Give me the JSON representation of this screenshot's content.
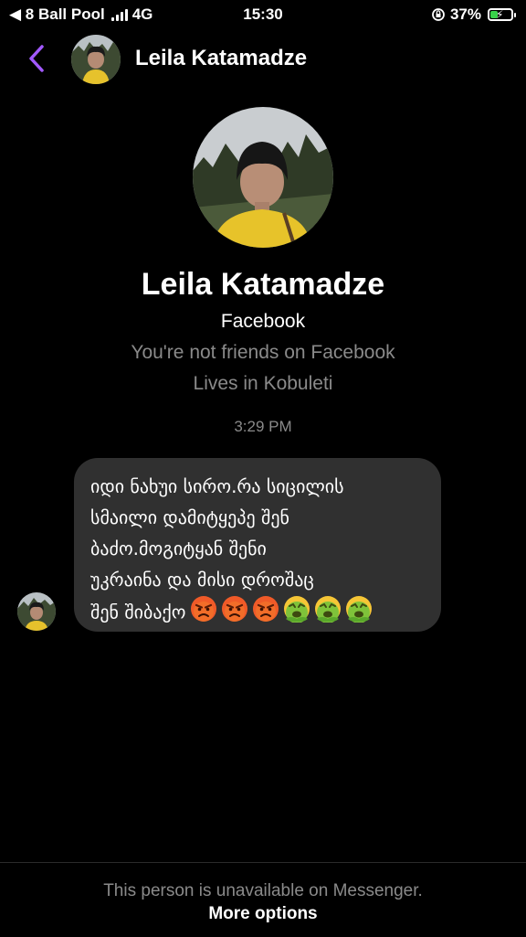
{
  "status_bar": {
    "back_app": "◀ 8 Ball Pool",
    "network": "4G",
    "time": "15:30",
    "battery": "37%",
    "battery_level": 0.37,
    "battery_color": "#39d24a"
  },
  "header": {
    "back_icon": "chevron-left-icon",
    "accent": "#a259ff",
    "name": "Leila Katamadze"
  },
  "profile": {
    "name": "Leila Katamadze",
    "source": "Facebook",
    "friend_status": "You're not friends on Facebook",
    "location": "Lives in Kobuleti"
  },
  "conversation": {
    "timestamp": "3:29 PM",
    "message": {
      "text": "იდი ნახუი სირო.რა სიცილის\nსმაილი დამიტყეპე შენ\nბაძო.მოგიტყან შენი\nუკრაინა და მისი დროშაც\nშენ შიბაქო",
      "emojis": [
        "angry-face",
        "angry-face",
        "angry-face",
        "nauseated-face",
        "nauseated-face",
        "nauseated-face"
      ]
    }
  },
  "footer": {
    "note": "This person is unavailable on Messenger.",
    "link": "More options"
  }
}
